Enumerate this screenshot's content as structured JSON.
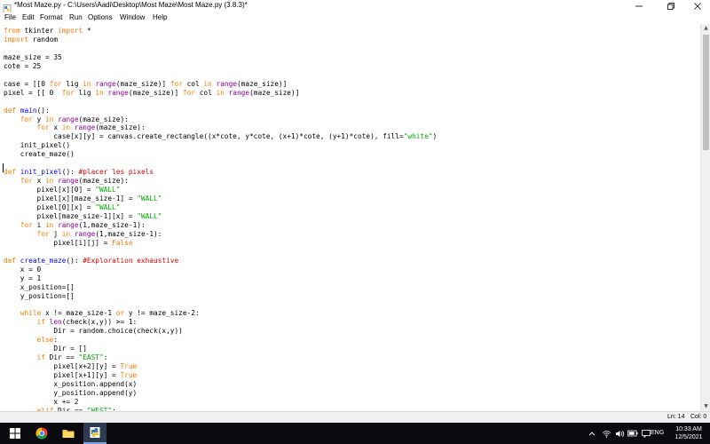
{
  "window": {
    "title": "*Most Maze.py - C:\\Users\\Aadi\\Desktop\\Most Maze\\Most Maze.py (3.8.3)*",
    "icons": {
      "app": "python-idle-icon",
      "minimize": "minimize-icon",
      "maximize": "restore-icon",
      "close": "close-icon"
    }
  },
  "menu": {
    "file": "File",
    "edit": "Edit",
    "format": "Format",
    "run": "Run",
    "options": "Options",
    "window": "Window",
    "help": "Help"
  },
  "colors": {
    "keyword": "#ff7700",
    "string": "#00aa00",
    "comment": "#dd0000",
    "definition": "#0000ff",
    "builtin": "#900090",
    "plain": "#000000"
  },
  "editor": {
    "lines": [
      [
        [
          "kw",
          "from"
        ],
        [
          "plain",
          " tkinter "
        ],
        [
          "kw",
          "import"
        ],
        [
          "plain",
          " *"
        ]
      ],
      [
        [
          "kw",
          "import"
        ],
        [
          "plain",
          " random"
        ]
      ],
      [],
      [
        [
          "plain",
          "maze_size = 35"
        ]
      ],
      [
        [
          "plain",
          "cote = 25"
        ]
      ],
      [],
      [
        [
          "plain",
          "case = [[0 "
        ],
        [
          "kw",
          "for"
        ],
        [
          "plain",
          " lig "
        ],
        [
          "kw",
          "in"
        ],
        [
          "plain",
          " "
        ],
        [
          "bi",
          "range"
        ],
        [
          "plain",
          "(maze_size)] "
        ],
        [
          "kw",
          "for"
        ],
        [
          "plain",
          " col "
        ],
        [
          "kw",
          "in"
        ],
        [
          "plain",
          " "
        ],
        [
          "bi",
          "range"
        ],
        [
          "plain",
          "(maze_size)]"
        ]
      ],
      [
        [
          "plain",
          "pixel = [[ 0  "
        ],
        [
          "kw",
          "for"
        ],
        [
          "plain",
          " lig "
        ],
        [
          "kw",
          "in"
        ],
        [
          "plain",
          " "
        ],
        [
          "bi",
          "range"
        ],
        [
          "plain",
          "(maze_size)] "
        ],
        [
          "kw",
          "for"
        ],
        [
          "plain",
          " col "
        ],
        [
          "kw",
          "in"
        ],
        [
          "plain",
          " "
        ],
        [
          "bi",
          "range"
        ],
        [
          "plain",
          "(maze_size)]"
        ]
      ],
      [],
      [
        [
          "kw",
          "def"
        ],
        [
          "plain",
          " "
        ],
        [
          "def",
          "main"
        ],
        [
          "plain",
          "():"
        ]
      ],
      [
        [
          "plain",
          "    "
        ],
        [
          "kw",
          "for"
        ],
        [
          "plain",
          " y "
        ],
        [
          "kw",
          "in"
        ],
        [
          "plain",
          " "
        ],
        [
          "bi",
          "range"
        ],
        [
          "plain",
          "(maze_size):"
        ]
      ],
      [
        [
          "plain",
          "        "
        ],
        [
          "kw",
          "for"
        ],
        [
          "plain",
          " x "
        ],
        [
          "kw",
          "in"
        ],
        [
          "plain",
          " "
        ],
        [
          "bi",
          "range"
        ],
        [
          "plain",
          "(maze_size):"
        ]
      ],
      [
        [
          "plain",
          "            case[x][y] = canvas.create_rectangle((x*cote, y*cote, (x+1)*cote, (y+1)*cote), fill="
        ],
        [
          "str",
          "\"white\""
        ],
        [
          "plain",
          ")"
        ]
      ],
      [
        [
          "plain",
          "    init_pixel()"
        ]
      ],
      [
        [
          "plain",
          "    create_maze()"
        ]
      ],
      [],
      [
        [
          "kw",
          "def"
        ],
        [
          "plain",
          " "
        ],
        [
          "def",
          "init_pixel"
        ],
        [
          "plain",
          "(): "
        ],
        [
          "com",
          "#placer les pixels"
        ]
      ],
      [
        [
          "plain",
          "    "
        ],
        [
          "kw",
          "for"
        ],
        [
          "plain",
          " x "
        ],
        [
          "kw",
          "in"
        ],
        [
          "plain",
          " "
        ],
        [
          "bi",
          "range"
        ],
        [
          "plain",
          "(maze_size):"
        ]
      ],
      [
        [
          "plain",
          "        pixel[x][0] = "
        ],
        [
          "str",
          "\"WALL\""
        ]
      ],
      [
        [
          "plain",
          "        pixel[x][maze_size-1] = "
        ],
        [
          "str",
          "\"WALL\""
        ]
      ],
      [
        [
          "plain",
          "        pixel[0][x] = "
        ],
        [
          "str",
          "\"WALL\""
        ]
      ],
      [
        [
          "plain",
          "        pixel[maze_size-1][x] = "
        ],
        [
          "str",
          "\"WALL\""
        ]
      ],
      [
        [
          "plain",
          "    "
        ],
        [
          "kw",
          "for"
        ],
        [
          "plain",
          " i "
        ],
        [
          "kw",
          "in"
        ],
        [
          "plain",
          " "
        ],
        [
          "bi",
          "range"
        ],
        [
          "plain",
          "(1,maze_size-1):"
        ]
      ],
      [
        [
          "plain",
          "        "
        ],
        [
          "kw",
          "for"
        ],
        [
          "plain",
          " j "
        ],
        [
          "kw",
          "in"
        ],
        [
          "plain",
          " "
        ],
        [
          "bi",
          "range"
        ],
        [
          "plain",
          "(1,maze_size-1):"
        ]
      ],
      [
        [
          "plain",
          "            pixel[i][j] = "
        ],
        [
          "kw",
          "False"
        ]
      ],
      [],
      [
        [
          "kw",
          "def"
        ],
        [
          "plain",
          " "
        ],
        [
          "def",
          "create_maze"
        ],
        [
          "plain",
          "(): "
        ],
        [
          "com",
          "#Exploration exhaustive"
        ]
      ],
      [
        [
          "plain",
          "    x = 0"
        ]
      ],
      [
        [
          "plain",
          "    y = 1"
        ]
      ],
      [
        [
          "plain",
          "    x_position=[]"
        ]
      ],
      [
        [
          "plain",
          "    y_position=[]"
        ]
      ],
      [],
      [
        [
          "plain",
          "    "
        ],
        [
          "kw",
          "while"
        ],
        [
          "plain",
          " x != maze_size-1 "
        ],
        [
          "kw",
          "or"
        ],
        [
          "plain",
          " y != maze_size-2:"
        ]
      ],
      [
        [
          "plain",
          "        "
        ],
        [
          "kw",
          "if"
        ],
        [
          "plain",
          " "
        ],
        [
          "bi",
          "len"
        ],
        [
          "plain",
          "(check(x,y)) >= 1:"
        ]
      ],
      [
        [
          "plain",
          "            Dir = random.choice(check(x,y))"
        ]
      ],
      [
        [
          "plain",
          "        "
        ],
        [
          "kw",
          "else"
        ],
        [
          "plain",
          ":"
        ]
      ],
      [
        [
          "plain",
          "            Dir = []"
        ]
      ],
      [
        [
          "plain",
          "        "
        ],
        [
          "kw",
          "if"
        ],
        [
          "plain",
          " Dir == "
        ],
        [
          "str",
          "\"EAST\""
        ],
        [
          "plain",
          ":"
        ]
      ],
      [
        [
          "plain",
          "            pixel[x+2][y] = "
        ],
        [
          "kw",
          "True"
        ]
      ],
      [
        [
          "plain",
          "            pixel[x+1][y] = "
        ],
        [
          "kw",
          "True"
        ]
      ],
      [
        [
          "plain",
          "            x_position.append(x)"
        ]
      ],
      [
        [
          "plain",
          "            y_position.append(y)"
        ]
      ],
      [
        [
          "plain",
          "            x += 2"
        ]
      ],
      [
        [
          "plain",
          "        "
        ],
        [
          "kw",
          "elif"
        ],
        [
          "plain",
          " Dir == "
        ],
        [
          "str",
          "\"WEST\""
        ],
        [
          "plain",
          ":"
        ]
      ]
    ]
  },
  "status": {
    "line": "Ln: 14",
    "col": "Col: 0"
  },
  "taskbar": {
    "apps": [
      "windows-start-icon",
      "chrome-icon",
      "file-explorer-icon",
      "python-idle-icon"
    ],
    "tray_icons": [
      "chevron-up-icon",
      "wifi-icon",
      "volume-icon",
      "battery-icon",
      "notification-icon"
    ],
    "language": "ENG",
    "time": "10:33 AM",
    "date": "12/5/2021"
  }
}
